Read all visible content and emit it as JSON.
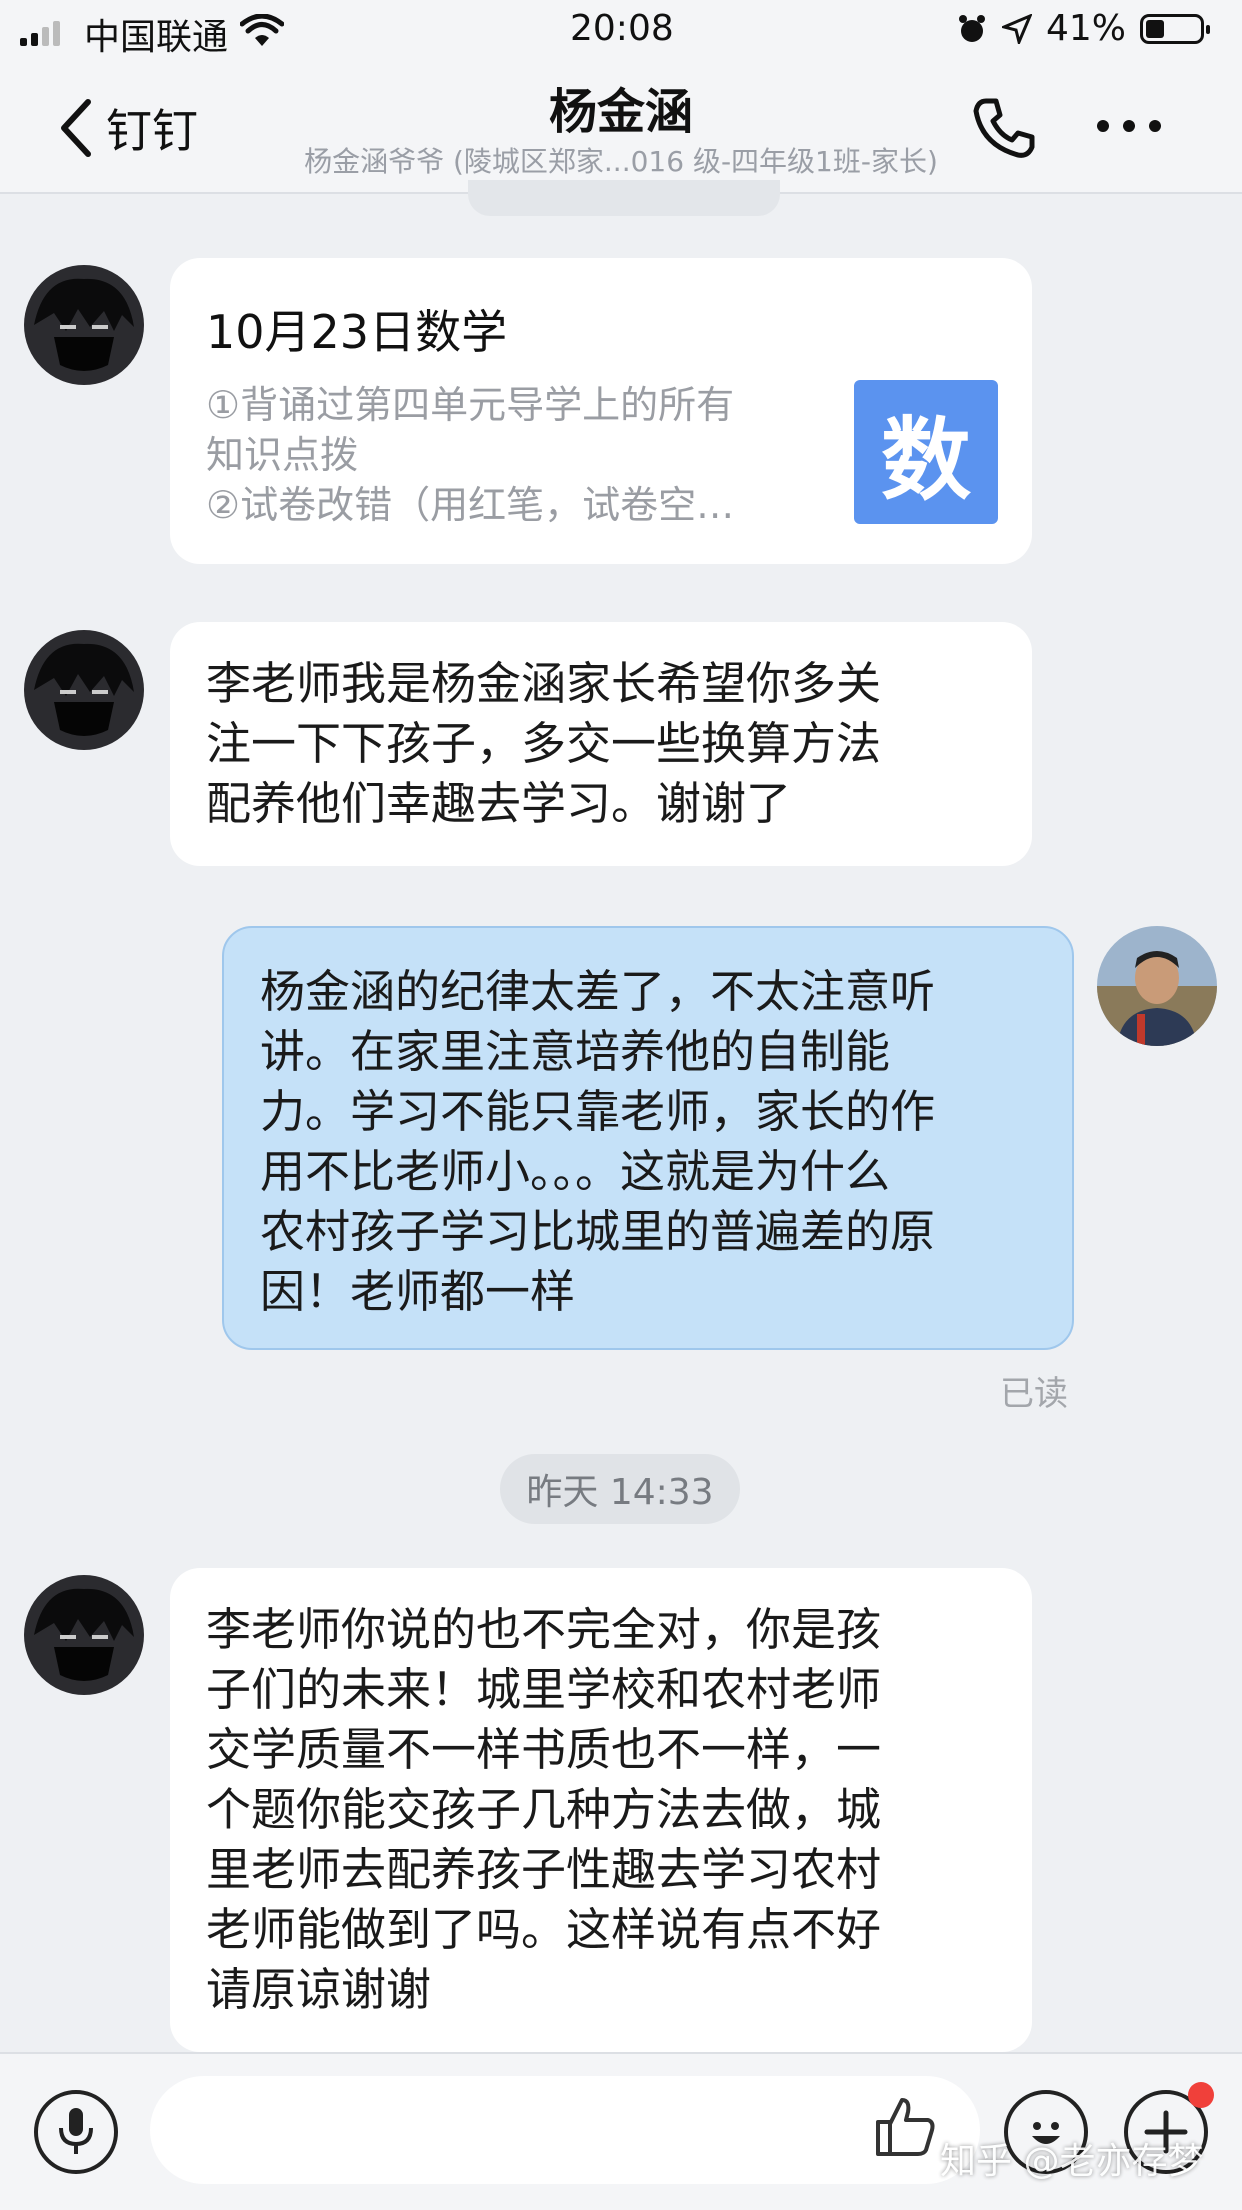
{
  "status_bar": {
    "carrier": "中国联通",
    "time": "20:08",
    "battery": "41%"
  },
  "nav": {
    "back_label": "钉钉",
    "title": "杨金涵",
    "subtitle": "杨金涵爷爷 (陵城区郑家...016 级-四年级1班-家长)"
  },
  "messages": {
    "card": {
      "title": "10月23日数学",
      "desc_lines": [
        "①背诵过第四单元导学上的所有",
        "知识点拨",
        "②试卷改错（用红笔，试卷空…"
      ],
      "icon_char": "数"
    },
    "msg1": {
      "lines": [
        "李老师我是杨金涵家长希望你多关",
        "注一下下孩子，多交一些换算方法",
        "配养他们幸趣去学习。谢谢了"
      ]
    },
    "msg2": {
      "lines": [
        "杨金涵的纪律太差了，不太注意听",
        "讲。在家里注意培养他的自制能",
        "力。学习不能只靠老师，家长的作",
        "用不比老师小。。。这就是为什么",
        "农村孩子学习比城里的普遍差的原",
        "因！老师都一样"
      ],
      "read_status": "已读"
    },
    "time_divider": "昨天 14:33",
    "msg3": {
      "lines": [
        "李老师你说的也不完全对，你是孩",
        "子们的未来！城里学校和农村老师",
        "交学质量不一样书质也不一样，一",
        "个题你能交孩子几种方法去做，城",
        "里老师去配养孩子性趣去学习农村",
        "老师能做到了吗。这样说有点不好",
        "请原谅谢谢"
      ]
    }
  },
  "input_bar": {
    "placeholder": ""
  },
  "watermark": "知乎 @老亦存梦",
  "colors": {
    "outgoing_bubble": "#c5e1f8",
    "subject_icon": "#5b93ef",
    "badge_dot": "#f0403a"
  }
}
